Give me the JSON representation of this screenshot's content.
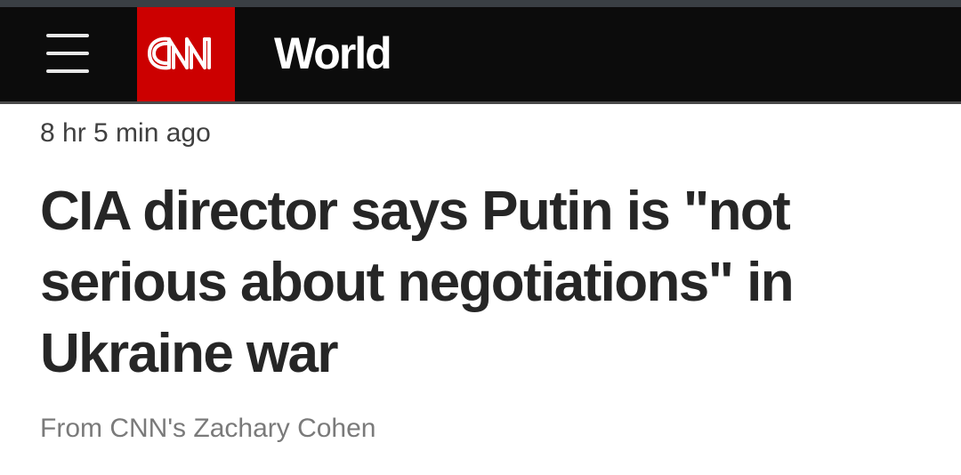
{
  "header": {
    "menu_icon": "hamburger-menu-icon",
    "logo_text": "CNN",
    "section_title": "World",
    "brand_color": "#cc0000",
    "background_color": "#0c0c0c"
  },
  "article": {
    "timestamp": "8 hr 5 min ago",
    "headline": "CIA director says Putin is \"not serious about negotiations\" in Ukraine war",
    "byline": "From CNN's Zachary Cohen"
  }
}
